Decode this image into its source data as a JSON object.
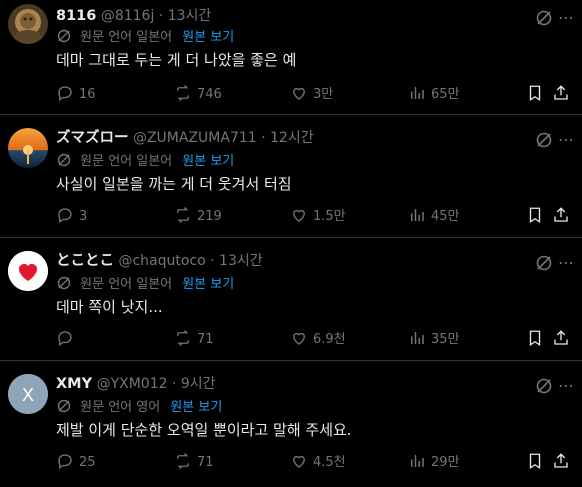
{
  "colors": {
    "background": "#000000",
    "text": "#e7e9ea",
    "muted": "#71767b",
    "link": "#1d9bf0",
    "divider": "#2f3336"
  },
  "translation": {
    "label": "원문 언어 일본어",
    "label_en": "원문 언어 영어",
    "link": "원본 보기"
  },
  "tweets": [
    {
      "name": "8116",
      "handle": "@8116j",
      "time": "· 13시간",
      "translation_label": "원문 언어 일본어",
      "translation_link": "원본 보기",
      "text": "데마 그대로 두는 게 더 나았을 좋은 예",
      "replies": "16",
      "retweets": "746",
      "likes": "3만",
      "views": "65만",
      "avatar": "lion-statue-avatar"
    },
    {
      "name": "ズマズロー",
      "handle": "@ZUMAZUMA711",
      "time": "· 12시간",
      "translation_label": "원문 언어 일본어",
      "translation_link": "원본 보기",
      "text": "사실이 일본을 까는 게 더 웃겨서 터짐",
      "replies": "3",
      "retweets": "219",
      "likes": "1.5만",
      "views": "45만",
      "avatar": "sunset-avatar"
    },
    {
      "name": "とことこ",
      "handle": "@chaqutoco",
      "time": "· 13시간",
      "translation_label": "원문 언어 일본어",
      "translation_link": "원본 보기",
      "text": "데마 쪽이 낫지...",
      "replies": "",
      "retweets": "71",
      "likes": "6.9천",
      "views": "35만",
      "avatar": "heart-avatar"
    },
    {
      "name": "XMY",
      "handle": "@YXM012",
      "time": "· 9시간",
      "translation_label": "원문 언어 영어",
      "translation_link": "원본 보기",
      "text": "제발 이게 단순한 오역일 뿐이라고 말해 주세요.",
      "replies": "25",
      "retweets": "71",
      "likes": "4.5천",
      "views": "29만",
      "avatar": "letter-x-avatar",
      "avatar_letter": "X"
    }
  ]
}
